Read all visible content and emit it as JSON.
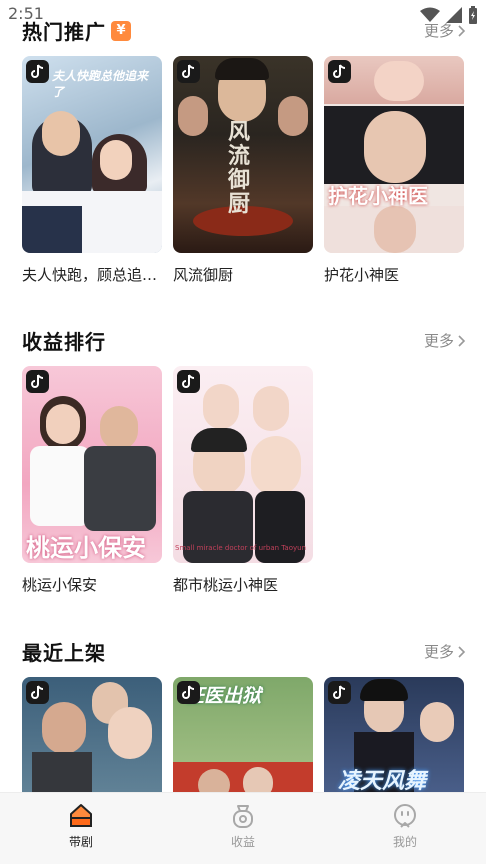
{
  "status": {
    "time": "2:51"
  },
  "sections": [
    {
      "title": "热门推广",
      "badge": "¥",
      "more": "更多",
      "cards": [
        {
          "title": "夫人快跑，顾总追来了",
          "poster_text": "夫人快跑总他追来了"
        },
        {
          "title": "风流御厨",
          "poster_text": "风流御厨"
        },
        {
          "title": "护花小神医",
          "poster_text": "护花小神医"
        }
      ]
    },
    {
      "title": "收益排行",
      "more": "更多",
      "cards": [
        {
          "title": "桃运小保安",
          "poster_text": "桃运小保安"
        },
        {
          "title": "都市桃运小神医",
          "poster_text": "Small miracle doctor of urban Taoyun"
        }
      ]
    },
    {
      "title": "最近上架",
      "more": "更多",
      "cards": [
        {
          "title": "",
          "poster_text": ""
        },
        {
          "title": "",
          "poster_text": "狂医出狱"
        },
        {
          "title": "",
          "poster_text": "凌天风舞"
        }
      ]
    }
  ],
  "nav": [
    {
      "label": "带剧",
      "icon": "home-icon",
      "active": true
    },
    {
      "label": "收益",
      "icon": "money-bag-icon",
      "active": false
    },
    {
      "label": "我的",
      "icon": "profile-icon",
      "active": false
    }
  ],
  "colors": {
    "accent": "#ff8a3d",
    "nav_bg": "#f7f7f7"
  }
}
